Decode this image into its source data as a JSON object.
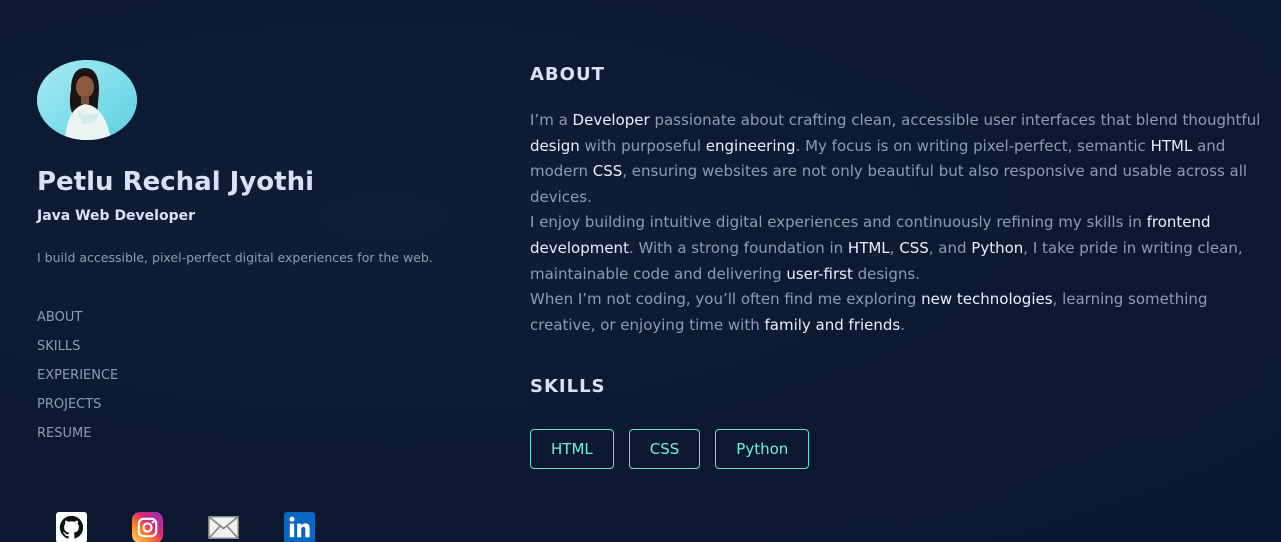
{
  "profile": {
    "name": "Petlu Rechal Jyothi",
    "role": "Java Web Developer",
    "tagline": "I build accessible, pixel-perfect digital experiences for the web."
  },
  "nav": {
    "items": [
      "ABOUT",
      "SKILLS",
      "EXPERIENCE",
      "PROJECTS",
      "RESUME"
    ]
  },
  "socials": [
    "github-icon",
    "instagram-icon",
    "mail-icon",
    "linkedin-icon"
  ],
  "about": {
    "title": "ABOUT",
    "p1": {
      "t1": "I’m a ",
      "h1": "Developer",
      "t2": " passionate about crafting clean, accessible user interfaces that blend thoughtful ",
      "h2": "design",
      "t3": " with purposeful ",
      "h3": "engineering",
      "t4": ". My focus is on writing pixel-perfect, semantic ",
      "h4": "HTML",
      "t5": " and modern ",
      "h5": "CSS",
      "t6": ", ensuring websites are not only beautiful but also responsive and usable across all devices."
    },
    "p2": {
      "t1": "I enjoy building intuitive digital experiences and continuously refining my skills in ",
      "h1": "frontend development",
      "t2": ". With a strong foundation in ",
      "h2": "HTML",
      "t3": ", ",
      "h3": "CSS",
      "t4": ", and ",
      "h4": "Python",
      "t5": ", I take pride in writing clean, maintainable code and delivering ",
      "h5": "user-first",
      "t6": " designs."
    },
    "p3": {
      "t1": "When I’m not coding, you’ll often find me exploring ",
      "h1": "new technologies",
      "t2": ", learning something creative, or enjoying time with ",
      "h2": "family and friends",
      "t3": "."
    }
  },
  "skills": {
    "title": "SKILLS",
    "items": [
      "HTML",
      "CSS",
      "Python"
    ]
  },
  "colors": {
    "background": "#0c1a33",
    "heading": "#d7e2f7",
    "body_text": "#8d9bb8",
    "accent": "#5ee0d4"
  }
}
